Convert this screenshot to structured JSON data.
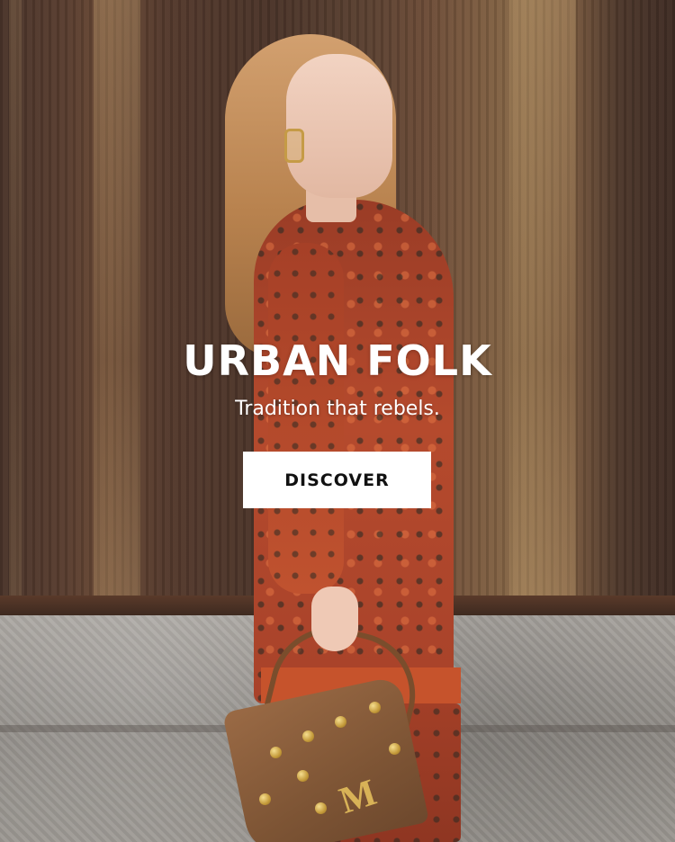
{
  "hero": {
    "title": "URBAN FOLK",
    "subtitle": "Tradition that rebels.",
    "cta_label": "DISCOVER",
    "bag_monogram": "M"
  },
  "colors": {
    "text": "#ffffff",
    "cta_background": "#ffffff",
    "cta_text": "#111111",
    "dress_accent": "#b54a2d"
  }
}
